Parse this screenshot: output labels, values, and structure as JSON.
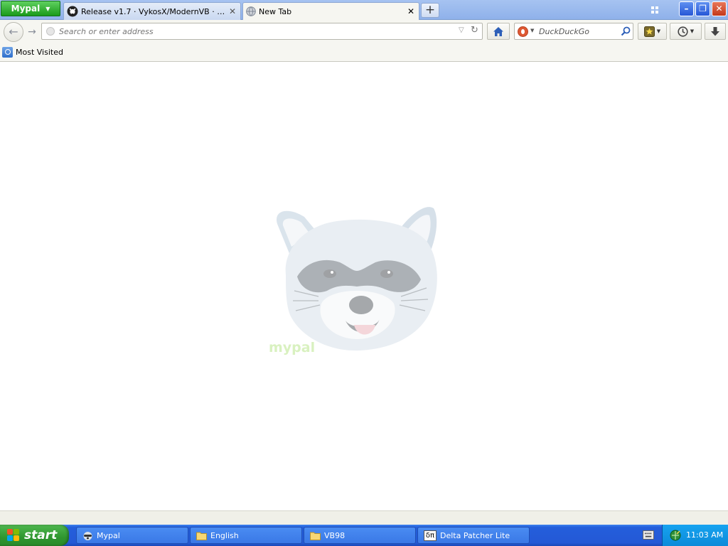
{
  "browser": {
    "app_menu_label": "Mypal",
    "tabs": [
      {
        "label": "Release v1.7 · VykosX/ModernVB · GitHub",
        "close": "✕",
        "icon": "github-icon",
        "active": false
      },
      {
        "label": "New Tab",
        "close": "✕",
        "icon": "globe-icon",
        "active": true
      }
    ],
    "new_tab_symbol": "+",
    "window_controls": {
      "minimize": "–",
      "restore": "❐",
      "close": "✕"
    }
  },
  "navbar": {
    "back_symbol": "←",
    "forward_symbol": "→",
    "address_placeholder": "Search or enter address",
    "address_value": "",
    "reload_symbol": "↻",
    "dropdown_symbol": "▽",
    "search_engine": "DuckDuckGo",
    "search_placeholder": "DuckDuckGo"
  },
  "bookmarks": {
    "items": [
      {
        "label": "Most Visited",
        "icon": "most-visited-icon"
      }
    ]
  },
  "content": {
    "mascot_text": "mypal"
  },
  "taskbar": {
    "start_label": "start",
    "tasks": [
      {
        "label": "Mypal",
        "icon": "raccoon-icon"
      },
      {
        "label": "English",
        "icon": "folder-icon"
      },
      {
        "label": "VB98",
        "icon": "folder-icon"
      },
      {
        "label": "Delta Patcher Lite",
        "icon": "delta-patcher-icon",
        "glyph": "δπ"
      }
    ],
    "clock": "11:03 AM"
  },
  "colors": {
    "brand_green": "#1a9a1a",
    "xp_blue": "#245edb",
    "tray_blue": "#0c8ad9"
  }
}
